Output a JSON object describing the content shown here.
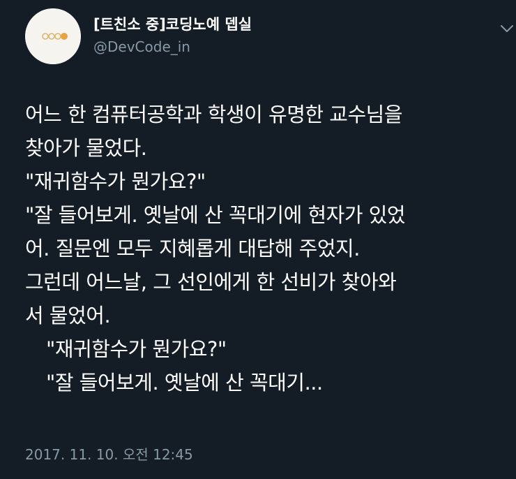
{
  "author": {
    "display_name": "[트친소 중]코딩노예 뎁실",
    "handle": "@DevCode_in",
    "avatar_icon": "orange-dots-logo"
  },
  "tweet": {
    "lines": [
      "어느 한 컴퓨터공학과 학생이 유명한 교수님을",
      "찾아가 물었다.",
      "\"재귀함수가 뭔가요?\"",
      "\"잘 들어보게. 옛날에 산 꼭대기에 현자가 있었",
      "어. 질문엔 모두 지혜롭게 대답해 주었지.",
      "그런데 어느날, 그 선인에게 한 선비가 찾아와",
      "서 물었어.",
      "\"재귀함수가 뭔가요?\"",
      "\"잘 들어보게. 옛날에 산 꼭대기..."
    ],
    "timestamp": "2017. 11. 10. 오전 12:45"
  },
  "colors": {
    "background": "#141d26",
    "text": "#ffffff",
    "secondary": "#8899a6",
    "avatar_bg": "#f6f4ef",
    "avatar_accent": "#e8a33d"
  },
  "icons": {
    "menu": "chevron-down-icon"
  }
}
